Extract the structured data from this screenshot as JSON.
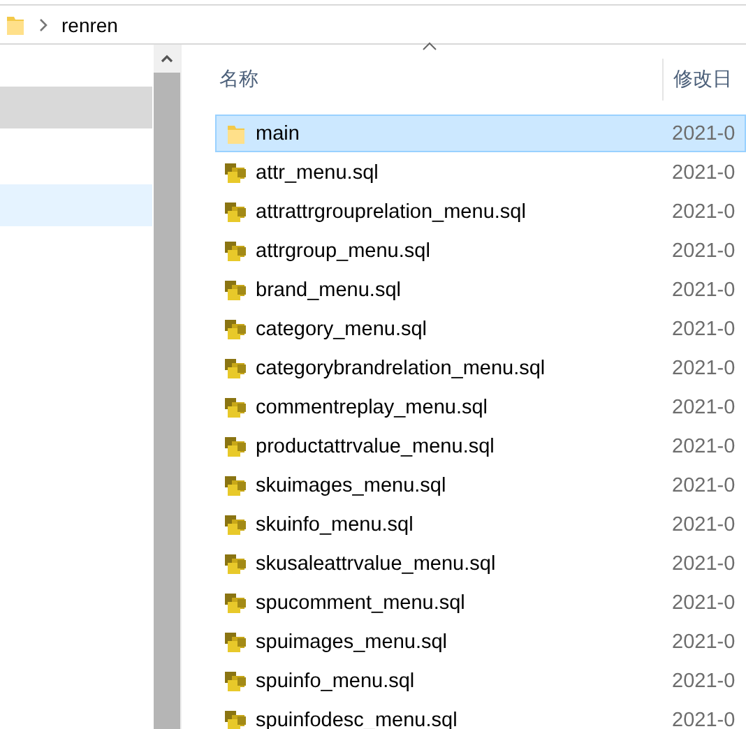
{
  "address_bar": {
    "path": [
      "renren"
    ]
  },
  "nav_pane": {
    "items": [
      {
        "selected": false,
        "hovered": true
      },
      {
        "selected": true,
        "hovered": false
      }
    ]
  },
  "file_list": {
    "columns": [
      {
        "label": "名称",
        "sorted": true
      },
      {
        "label": "修改日"
      }
    ],
    "rows": [
      {
        "kind": "folder",
        "name": "main",
        "date": "2021-0",
        "selected": true
      },
      {
        "kind": "sql",
        "name": "attr_menu.sql",
        "date": "2021-0",
        "selected": false
      },
      {
        "kind": "sql",
        "name": "attrattrgrouprelation_menu.sql",
        "date": "2021-0",
        "selected": false
      },
      {
        "kind": "sql",
        "name": "attrgroup_menu.sql",
        "date": "2021-0",
        "selected": false
      },
      {
        "kind": "sql",
        "name": "brand_menu.sql",
        "date": "2021-0",
        "selected": false
      },
      {
        "kind": "sql",
        "name": "category_menu.sql",
        "date": "2021-0",
        "selected": false
      },
      {
        "kind": "sql",
        "name": "categorybrandrelation_menu.sql",
        "date": "2021-0",
        "selected": false
      },
      {
        "kind": "sql",
        "name": "commentreplay_menu.sql",
        "date": "2021-0",
        "selected": false
      },
      {
        "kind": "sql",
        "name": "productattrvalue_menu.sql",
        "date": "2021-0",
        "selected": false
      },
      {
        "kind": "sql",
        "name": "skuimages_menu.sql",
        "date": "2021-0",
        "selected": false
      },
      {
        "kind": "sql",
        "name": "skuinfo_menu.sql",
        "date": "2021-0",
        "selected": false
      },
      {
        "kind": "sql",
        "name": "skusaleattrvalue_menu.sql",
        "date": "2021-0",
        "selected": false
      },
      {
        "kind": "sql",
        "name": "spucomment_menu.sql",
        "date": "2021-0",
        "selected": false
      },
      {
        "kind": "sql",
        "name": "spuimages_menu.sql",
        "date": "2021-0",
        "selected": false
      },
      {
        "kind": "sql",
        "name": "spuinfo_menu.sql",
        "date": "2021-0",
        "selected": false
      },
      {
        "kind": "sql",
        "name": "spuinfodesc_menu.sql",
        "date": "2021-0",
        "selected": false
      }
    ]
  }
}
